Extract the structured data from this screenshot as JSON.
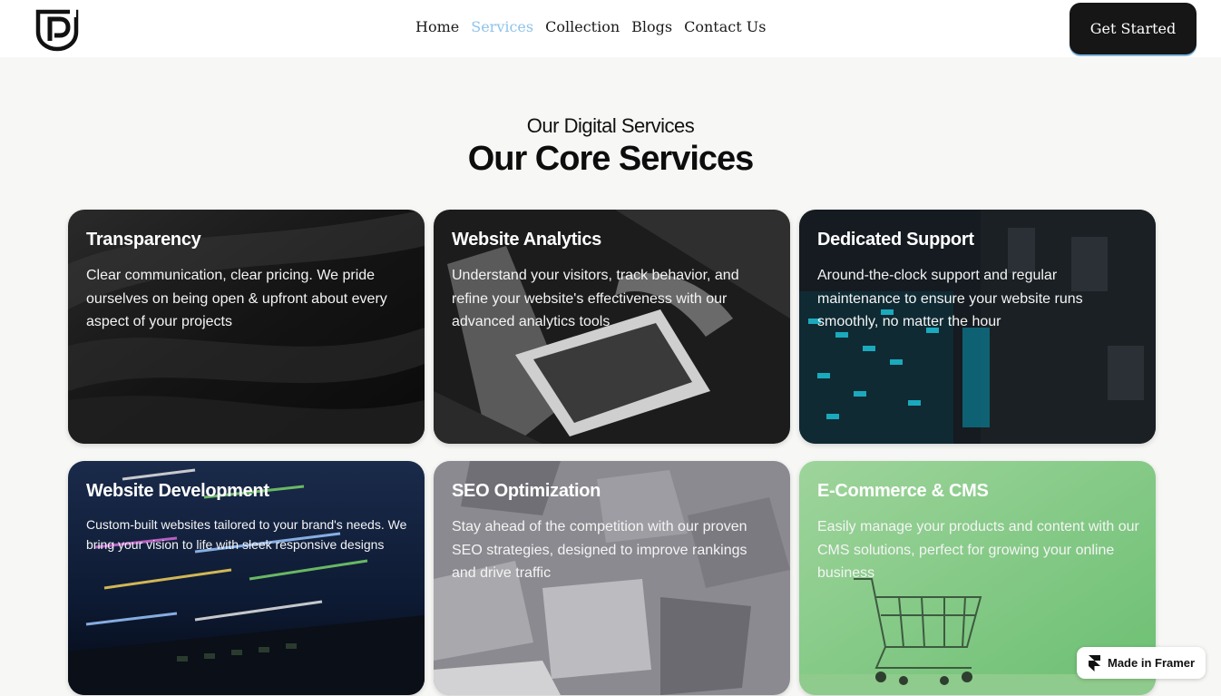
{
  "nav": {
    "links": [
      {
        "label": "Home",
        "active": false
      },
      {
        "label": "Services",
        "active": true
      },
      {
        "label": "Collection",
        "active": false
      },
      {
        "label": "Blogs",
        "active": false
      },
      {
        "label": "Contact Us",
        "active": false
      }
    ],
    "cta_label": "Get Started"
  },
  "section": {
    "eyebrow": "Our Digital Services",
    "heading": "Our Core Services"
  },
  "cards": [
    {
      "title": "Transparency",
      "description": "Clear communication, clear pricing. We pride ourselves on being open & upfront about every aspect of your projects"
    },
    {
      "title": "Website Analytics",
      "description": "Understand your visitors, track behavior, and refine your website's effectiveness with our advanced analytics tools"
    },
    {
      "title": "Dedicated Support",
      "description": "Around-the-clock support and regular maintenance to ensure your website runs smoothly, no matter the hour"
    },
    {
      "title": "Website Development",
      "description": "Custom-built websites tailored to your brand's needs. We bring your vision to life with sleek responsive designs"
    },
    {
      "title": "SEO Optimization",
      "description": "Stay ahead of the competition with our proven SEO strategies, designed to improve rankings and drive traffic"
    },
    {
      "title": "E-Commerce & CMS",
      "description": "Easily manage your products and content with our CMS solutions, perfect for growing your online business"
    }
  ],
  "badge": {
    "label": "Made in Framer"
  },
  "colors": {
    "accent": "#8fc3ea",
    "dark": "#161616",
    "page_bg": "#f7f7f5"
  },
  "icons": {
    "logo": "shield-p-logo-icon",
    "framer": "framer-logo-icon"
  }
}
